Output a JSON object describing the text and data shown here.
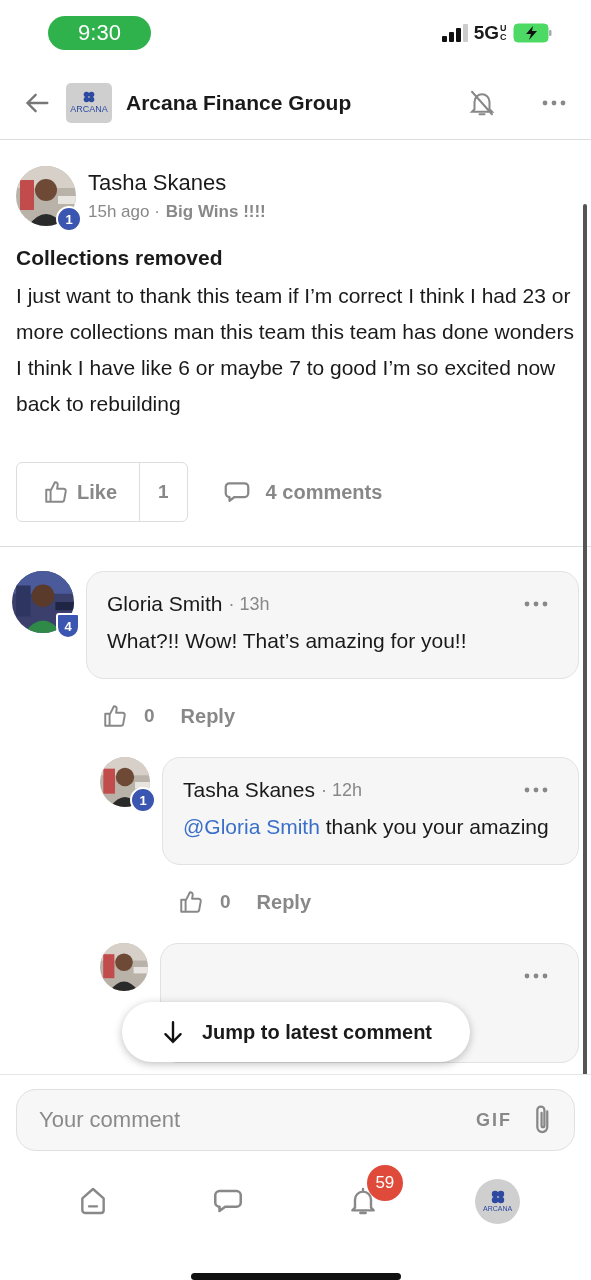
{
  "status_bar": {
    "time": "9:30",
    "network": "5G",
    "network_suffix": "UC"
  },
  "header": {
    "logo_text": "ARCANA",
    "title": "Arcana Finance Group"
  },
  "post": {
    "author": "Tasha Skanes",
    "level_badge": "1",
    "time": "15h ago ·",
    "category": "Big Wins !!!!",
    "title": "Collections removed",
    "body": "I just want to thank this team if I’m correct I think I had 23 or more collections man this team this team has done wonders I think I have like 6 or maybe 7 to good I’m so excited now back to rebuilding",
    "like_label": "Like",
    "like_count": "1",
    "liked": false,
    "comments_label": "4 comments"
  },
  "comments": [
    {
      "kind": "comment",
      "author": "Gloria Smith",
      "badge": "4",
      "time": "· 13h",
      "text": "What?!! Wow! That’s amazing for you!!",
      "like_count": "0",
      "reply_label": "Reply",
      "replies": [
        {
          "kind": "reply",
          "author": "Tasha Skanes",
          "badge": "1",
          "time": "· 12h",
          "mention": "@Gloria Smith",
          "text": "thank you your amazing",
          "like_count": "0",
          "reply_label": "Reply"
        },
        {
          "kind": "cut"
        }
      ]
    }
  ],
  "jump_button": {
    "label": "Jump to latest comment"
  },
  "composer": {
    "placeholder": "Your comment",
    "gif_label": "GIF"
  },
  "nav": [
    {
      "kind": "home"
    },
    {
      "kind": "chat"
    },
    {
      "kind": "bell",
      "badge": "59"
    },
    {
      "kind": "profile",
      "text": "ARCANA"
    }
  ]
}
